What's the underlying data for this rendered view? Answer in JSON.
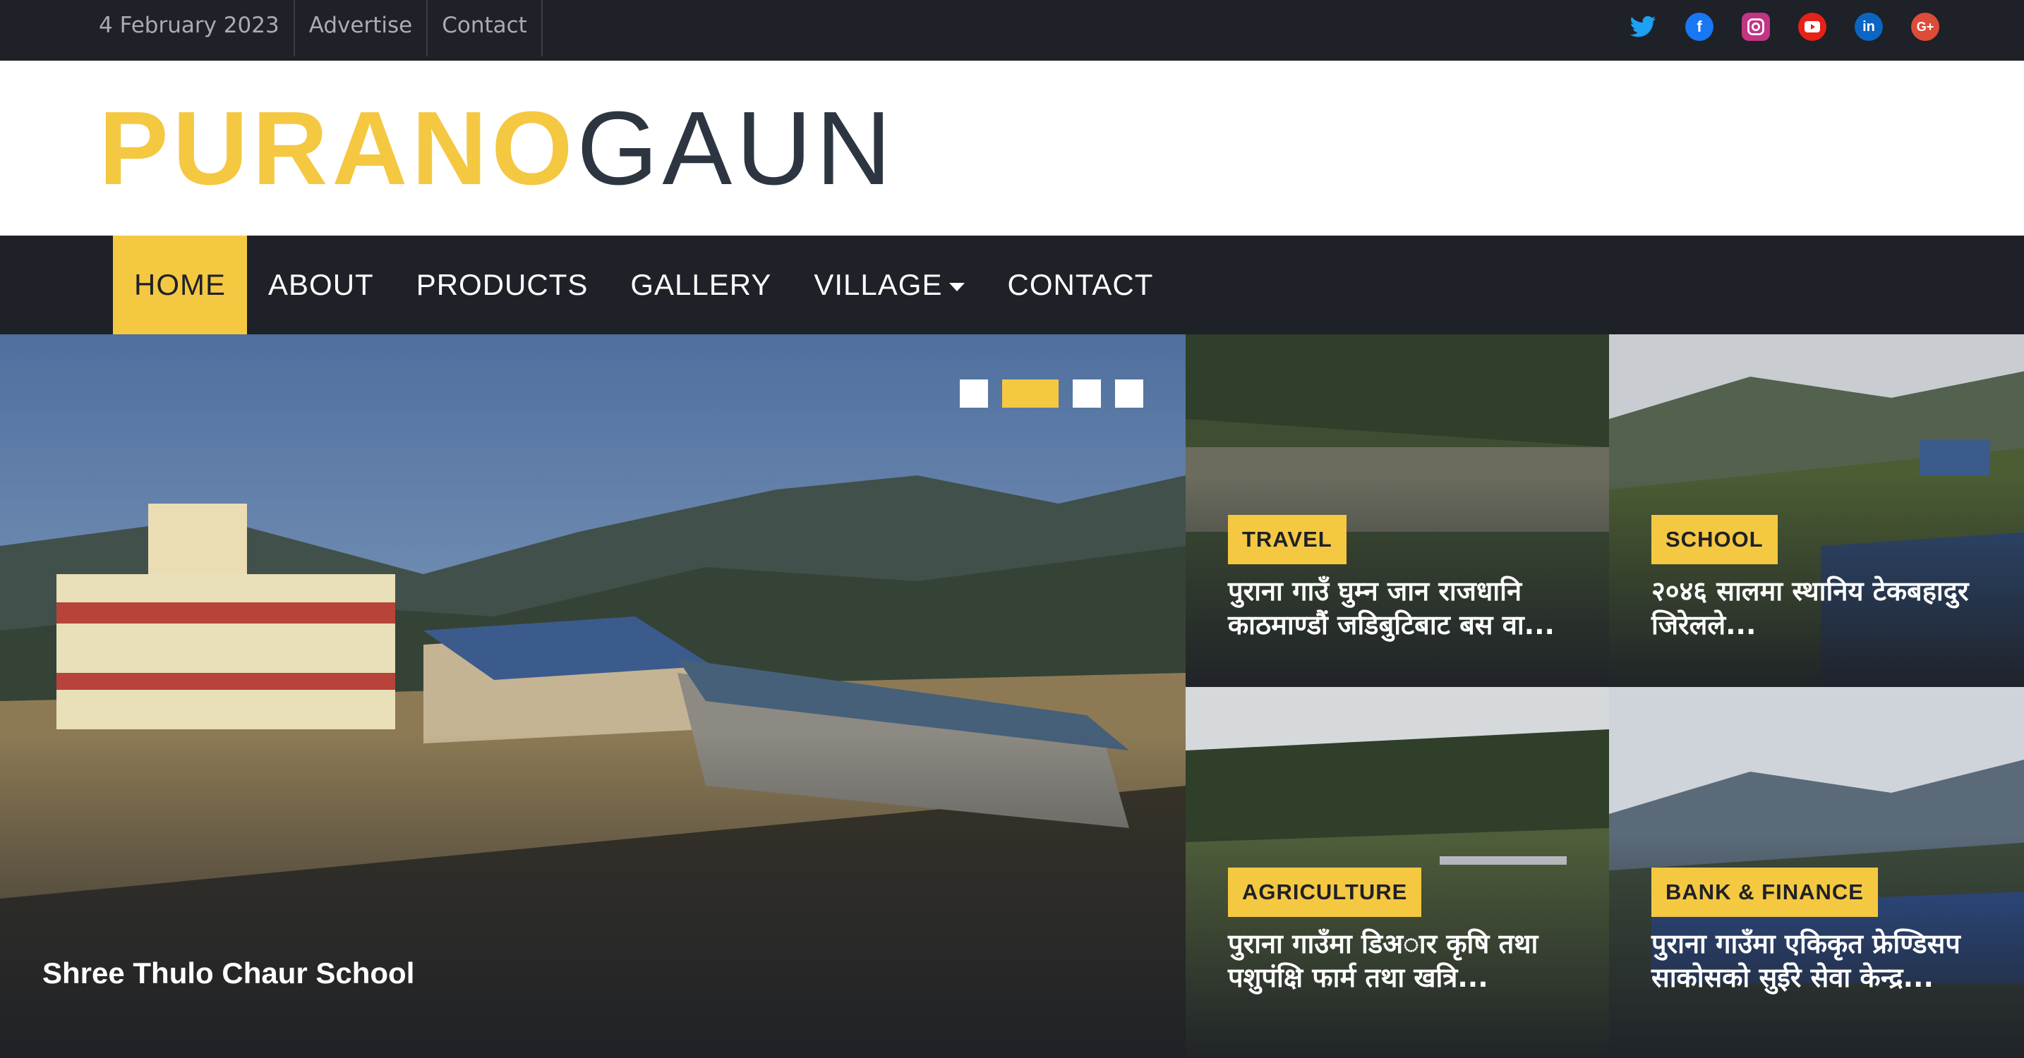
{
  "topbar": {
    "date": "4 February 2023",
    "advertise": "Advertise",
    "contact": "Contact",
    "social": [
      {
        "name": "twitter-icon",
        "glyph": "🐦",
        "color": "#1da1f2"
      },
      {
        "name": "facebook-icon",
        "glyph": "f",
        "color": "#1877f2"
      },
      {
        "name": "instagram-icon",
        "glyph": "◎",
        "color": "#c13584"
      },
      {
        "name": "youtube-icon",
        "glyph": "▶",
        "color": "#e62117"
      },
      {
        "name": "linkedin-icon",
        "glyph": "in",
        "color": "#0a66c2"
      },
      {
        "name": "google-plus-icon",
        "glyph": "G+",
        "color": "#dd4b39"
      }
    ]
  },
  "logo": {
    "part1": "PURANO",
    "part2": "GAUN"
  },
  "nav": {
    "items": [
      "HOME",
      "ABOUT",
      "PRODUCTS",
      "GALLERY",
      "VILLAGE",
      "CONTACT"
    ],
    "active": "HOME"
  },
  "hero": {
    "title": "Shree Thulo Chaur School",
    "slides": 4,
    "active_slide": 2
  },
  "tiles": [
    {
      "category": "TRAVEL",
      "title": "पुराना गाउँ घुम्न जान राजधानि काठमाण्डौं जडिबुटिबाट बस वा..."
    },
    {
      "category": "SCHOOL",
      "title": "२०४६ सालमा स्थानिय टेकबहादुर जिरेलले..."
    },
    {
      "category": "AGRICULTURE",
      "title": "पुराना गाउँमा डिअार कृषि तथा पशुपंक्षि फार्म तथा खत्रि..."
    },
    {
      "category": "BANK & FINANCE",
      "title": "पुराना गाउँमा एकिकृत फ्रेण्डिसप साकोसको सुईरे सेवा केन्द्र..."
    }
  ],
  "colors": {
    "accent": "#f5c842",
    "dark": "#1e2127",
    "logo_dark": "#2d3640"
  }
}
